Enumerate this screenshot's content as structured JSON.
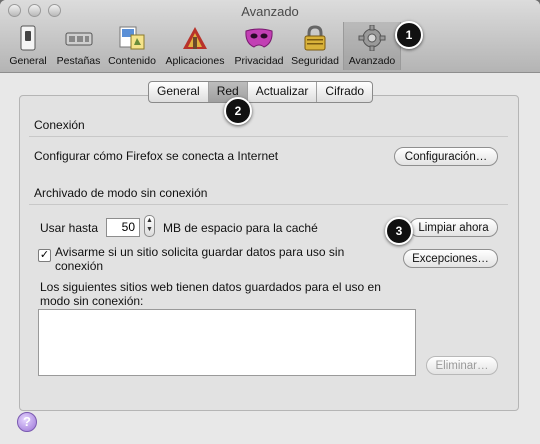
{
  "window": {
    "title": "Avanzado"
  },
  "toolbar": {
    "items": [
      {
        "label": "General",
        "icon": "general-switch-icon"
      },
      {
        "label": "Pestañas",
        "icon": "tabs-icon"
      },
      {
        "label": "Contenido",
        "icon": "content-icon"
      },
      {
        "label": "Aplicaciones",
        "icon": "applications-icon"
      },
      {
        "label": "Privacidad",
        "icon": "privacy-mask-icon"
      },
      {
        "label": "Seguridad",
        "icon": "padlock-icon"
      },
      {
        "label": "Avanzado",
        "icon": "gear-icon",
        "selected": true
      }
    ]
  },
  "tabs": [
    {
      "label": "General"
    },
    {
      "label": "Red",
      "selected": true
    },
    {
      "label": "Actualizar"
    },
    {
      "label": "Cifrado"
    }
  ],
  "connection": {
    "heading": "Conexión",
    "description": "Configurar cómo Firefox se conecta a Internet",
    "settings_button": "Configuración…"
  },
  "offline": {
    "heading": "Archivado de modo sin conexión",
    "use_up_to_label": "Usar hasta",
    "cache_value": "50",
    "cache_units_label": "MB de espacio para la caché",
    "clear_button": "Limpiar ahora",
    "notify_checked": true,
    "notify_label_line1": "Avisarme si un sitio solicita guardar datos para uso sin",
    "notify_label_line2": "conexión",
    "exceptions_button": "Excepciones…",
    "sites_label_line1": "Los siguientes sitios web tienen datos guardados para el uso en",
    "sites_label_line2": "modo sin conexión:",
    "remove_button": "Eliminar…"
  },
  "annotations": [
    "1",
    "2",
    "3"
  ],
  "help": {
    "glyph": "?"
  }
}
